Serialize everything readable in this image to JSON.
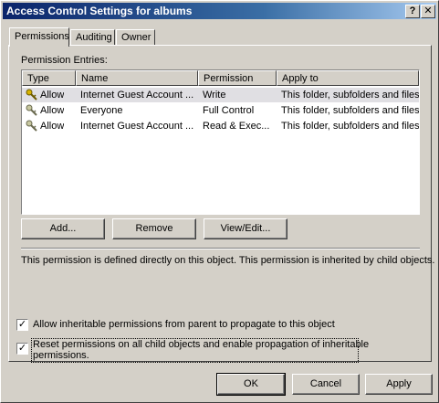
{
  "window": {
    "title": "Access Control Settings for albums",
    "help_btn": "?",
    "close_btn": "✕"
  },
  "tabs": [
    {
      "label": "Permissions",
      "active": true
    },
    {
      "label": "Auditing",
      "active": false
    },
    {
      "label": "Owner",
      "active": false
    }
  ],
  "permissions": {
    "entries_label": "Permission Entries:",
    "columns": [
      "Type",
      "Name",
      "Permission",
      "Apply to"
    ],
    "rows": [
      {
        "type": "Allow",
        "name": "Internet Guest Account ...",
        "permission": "Write",
        "apply_to": "This folder, subfolders and files"
      },
      {
        "type": "Allow",
        "name": "Everyone",
        "permission": "Full Control",
        "apply_to": "This folder, subfolders and files"
      },
      {
        "type": "Allow",
        "name": "Internet Guest Account ...",
        "permission": "Read & Exec...",
        "apply_to": "This folder, subfolders and files"
      }
    ],
    "buttons": {
      "add": "Add...",
      "remove": "Remove",
      "view_edit": "View/Edit..."
    },
    "description": "This permission is defined directly on this object. This permission is inherited by child objects.",
    "allow_inheritable_label": "Allow inheritable permissions from parent to propagate to this object",
    "allow_inheritable_checked": true,
    "reset_label_line1": "Reset permissions on all child objects and enable propagation of inheritable",
    "reset_label_line2": "permissions.",
    "reset_checked": true
  },
  "footer": {
    "ok": "OK",
    "cancel": "Cancel",
    "apply": "Apply"
  }
}
